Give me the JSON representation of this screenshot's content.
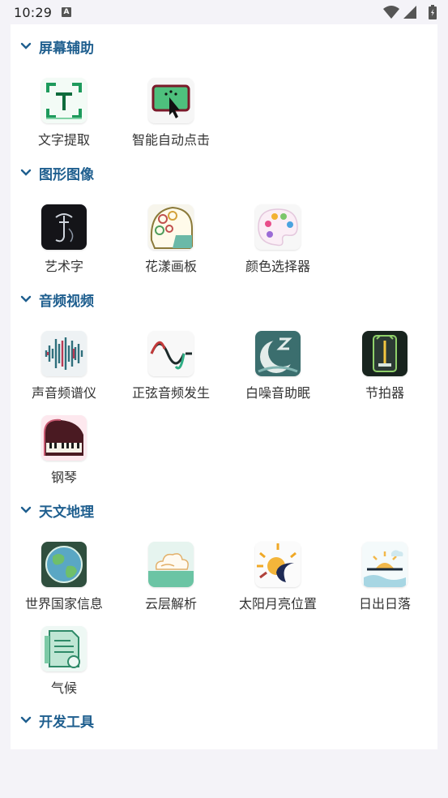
{
  "status_bar": {
    "time": "10:29",
    "notification_glyph": "A"
  },
  "sections": [
    {
      "title": "屏幕辅助",
      "items": [
        {
          "label": "文字提取"
        },
        {
          "label": "智能自动点击"
        }
      ]
    },
    {
      "title": "图形图像",
      "items": [
        {
          "label": "艺术字"
        },
        {
          "label": "花漾画板"
        },
        {
          "label": "颜色选择器"
        }
      ]
    },
    {
      "title": "音频视频",
      "items": [
        {
          "label": "声音频谱仪"
        },
        {
          "label": "正弦音频发生"
        },
        {
          "label": "白噪音助眠"
        },
        {
          "label": "节拍器"
        },
        {
          "label": "钢琴"
        }
      ]
    },
    {
      "title": "天文地理",
      "items": [
        {
          "label": "世界国家信息"
        },
        {
          "label": "云层解析"
        },
        {
          "label": "太阳月亮位置"
        },
        {
          "label": "日出日落"
        },
        {
          "label": "气候"
        }
      ]
    },
    {
      "title": "开发工具",
      "items": []
    }
  ],
  "colors": {
    "section_title": "#1f5f8f",
    "background": "#f4f3f8",
    "panel": "#ffffff"
  }
}
